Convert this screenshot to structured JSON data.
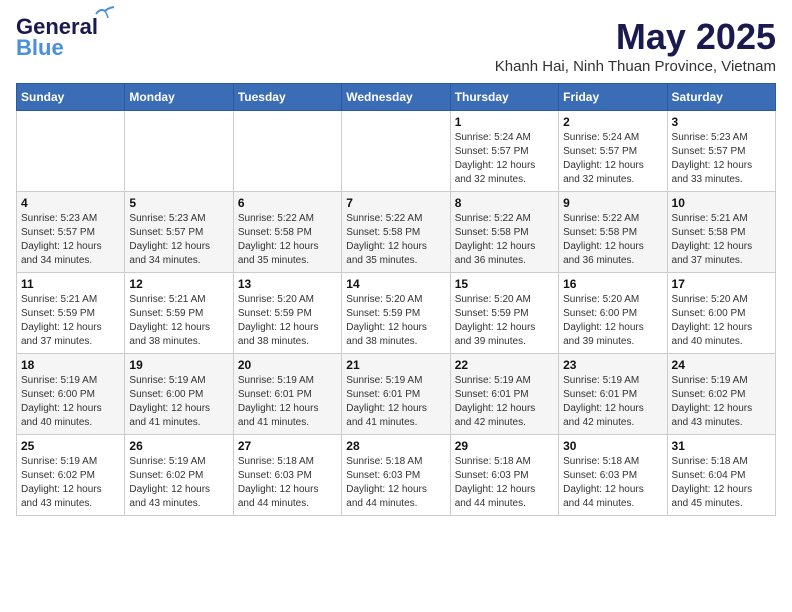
{
  "header": {
    "logo_line1": "General",
    "logo_line2": "Blue",
    "month": "May 2025",
    "location": "Khanh Hai, Ninh Thuan Province, Vietnam"
  },
  "weekdays": [
    "Sunday",
    "Monday",
    "Tuesday",
    "Wednesday",
    "Thursday",
    "Friday",
    "Saturday"
  ],
  "weeks": [
    [
      {
        "day": "",
        "info": ""
      },
      {
        "day": "",
        "info": ""
      },
      {
        "day": "",
        "info": ""
      },
      {
        "day": "",
        "info": ""
      },
      {
        "day": "1",
        "info": "Sunrise: 5:24 AM\nSunset: 5:57 PM\nDaylight: 12 hours\nand 32 minutes."
      },
      {
        "day": "2",
        "info": "Sunrise: 5:24 AM\nSunset: 5:57 PM\nDaylight: 12 hours\nand 32 minutes."
      },
      {
        "day": "3",
        "info": "Sunrise: 5:23 AM\nSunset: 5:57 PM\nDaylight: 12 hours\nand 33 minutes."
      }
    ],
    [
      {
        "day": "4",
        "info": "Sunrise: 5:23 AM\nSunset: 5:57 PM\nDaylight: 12 hours\nand 34 minutes."
      },
      {
        "day": "5",
        "info": "Sunrise: 5:23 AM\nSunset: 5:57 PM\nDaylight: 12 hours\nand 34 minutes."
      },
      {
        "day": "6",
        "info": "Sunrise: 5:22 AM\nSunset: 5:58 PM\nDaylight: 12 hours\nand 35 minutes."
      },
      {
        "day": "7",
        "info": "Sunrise: 5:22 AM\nSunset: 5:58 PM\nDaylight: 12 hours\nand 35 minutes."
      },
      {
        "day": "8",
        "info": "Sunrise: 5:22 AM\nSunset: 5:58 PM\nDaylight: 12 hours\nand 36 minutes."
      },
      {
        "day": "9",
        "info": "Sunrise: 5:22 AM\nSunset: 5:58 PM\nDaylight: 12 hours\nand 36 minutes."
      },
      {
        "day": "10",
        "info": "Sunrise: 5:21 AM\nSunset: 5:58 PM\nDaylight: 12 hours\nand 37 minutes."
      }
    ],
    [
      {
        "day": "11",
        "info": "Sunrise: 5:21 AM\nSunset: 5:59 PM\nDaylight: 12 hours\nand 37 minutes."
      },
      {
        "day": "12",
        "info": "Sunrise: 5:21 AM\nSunset: 5:59 PM\nDaylight: 12 hours\nand 38 minutes."
      },
      {
        "day": "13",
        "info": "Sunrise: 5:20 AM\nSunset: 5:59 PM\nDaylight: 12 hours\nand 38 minutes."
      },
      {
        "day": "14",
        "info": "Sunrise: 5:20 AM\nSunset: 5:59 PM\nDaylight: 12 hours\nand 38 minutes."
      },
      {
        "day": "15",
        "info": "Sunrise: 5:20 AM\nSunset: 5:59 PM\nDaylight: 12 hours\nand 39 minutes."
      },
      {
        "day": "16",
        "info": "Sunrise: 5:20 AM\nSunset: 6:00 PM\nDaylight: 12 hours\nand 39 minutes."
      },
      {
        "day": "17",
        "info": "Sunrise: 5:20 AM\nSunset: 6:00 PM\nDaylight: 12 hours\nand 40 minutes."
      }
    ],
    [
      {
        "day": "18",
        "info": "Sunrise: 5:19 AM\nSunset: 6:00 PM\nDaylight: 12 hours\nand 40 minutes."
      },
      {
        "day": "19",
        "info": "Sunrise: 5:19 AM\nSunset: 6:00 PM\nDaylight: 12 hours\nand 41 minutes."
      },
      {
        "day": "20",
        "info": "Sunrise: 5:19 AM\nSunset: 6:01 PM\nDaylight: 12 hours\nand 41 minutes."
      },
      {
        "day": "21",
        "info": "Sunrise: 5:19 AM\nSunset: 6:01 PM\nDaylight: 12 hours\nand 41 minutes."
      },
      {
        "day": "22",
        "info": "Sunrise: 5:19 AM\nSunset: 6:01 PM\nDaylight: 12 hours\nand 42 minutes."
      },
      {
        "day": "23",
        "info": "Sunrise: 5:19 AM\nSunset: 6:01 PM\nDaylight: 12 hours\nand 42 minutes."
      },
      {
        "day": "24",
        "info": "Sunrise: 5:19 AM\nSunset: 6:02 PM\nDaylight: 12 hours\nand 43 minutes."
      }
    ],
    [
      {
        "day": "25",
        "info": "Sunrise: 5:19 AM\nSunset: 6:02 PM\nDaylight: 12 hours\nand 43 minutes."
      },
      {
        "day": "26",
        "info": "Sunrise: 5:19 AM\nSunset: 6:02 PM\nDaylight: 12 hours\nand 43 minutes."
      },
      {
        "day": "27",
        "info": "Sunrise: 5:18 AM\nSunset: 6:03 PM\nDaylight: 12 hours\nand 44 minutes."
      },
      {
        "day": "28",
        "info": "Sunrise: 5:18 AM\nSunset: 6:03 PM\nDaylight: 12 hours\nand 44 minutes."
      },
      {
        "day": "29",
        "info": "Sunrise: 5:18 AM\nSunset: 6:03 PM\nDaylight: 12 hours\nand 44 minutes."
      },
      {
        "day": "30",
        "info": "Sunrise: 5:18 AM\nSunset: 6:03 PM\nDaylight: 12 hours\nand 44 minutes."
      },
      {
        "day": "31",
        "info": "Sunrise: 5:18 AM\nSunset: 6:04 PM\nDaylight: 12 hours\nand 45 minutes."
      }
    ]
  ]
}
